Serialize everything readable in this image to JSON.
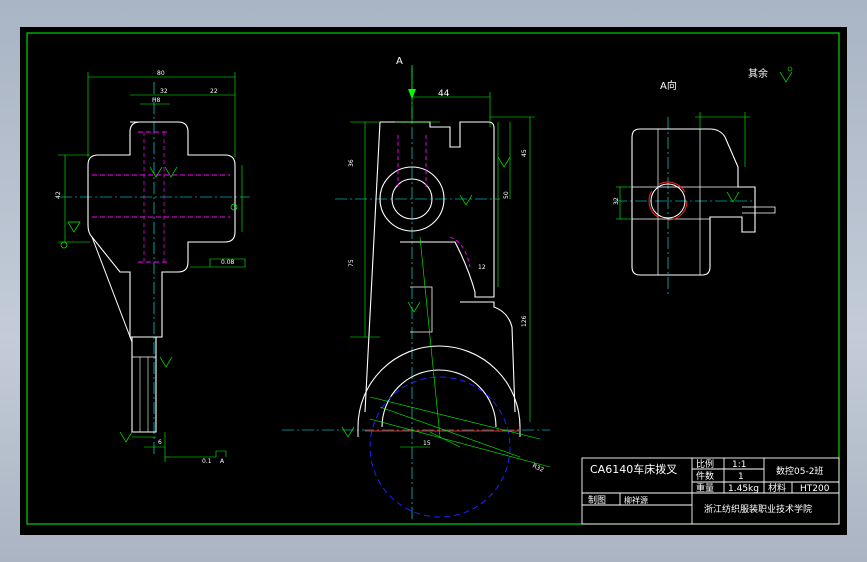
{
  "view_labels": {
    "arrow_letter": "A",
    "view_a": "A向",
    "rough_note": "其余"
  },
  "dimensions": {
    "left": {
      "d80": "80",
      "d32": "32",
      "d22": "22",
      "d42": "42",
      "h8": "H8",
      "f0_08": "0.08",
      "f0_1": "0.1",
      "a": "A",
      "d6": "6"
    },
    "center": {
      "d44": "44",
      "d36": "36",
      "d45": "45",
      "d50": "50",
      "d75": "75",
      "d126": "126",
      "d12": "12",
      "d15": "15",
      "r32": "R32"
    },
    "right": {
      "d32": "32"
    }
  },
  "title_block": {
    "part_name": "CA6140车床拨叉",
    "scale_label": "比例",
    "scale_value": "1:1",
    "qty_label": "件数",
    "qty_value": "1",
    "class_label": "数控05-2班",
    "weight_label": "重量",
    "weight_value": "1.45kg",
    "material_label": "材料",
    "material_value": "HT200",
    "drawn_label": "制图",
    "drawn_by": "柳祥源",
    "school": "浙江纺织服装职业技术学院"
  },
  "colors": {
    "frame": "#00ff00",
    "outline": "#ffffff",
    "center_line": "#00ffff",
    "hidden": "#ff00ff",
    "dim": "#00ff00",
    "accent_red": "#ff2020",
    "accent_blue": "#2020ff"
  }
}
